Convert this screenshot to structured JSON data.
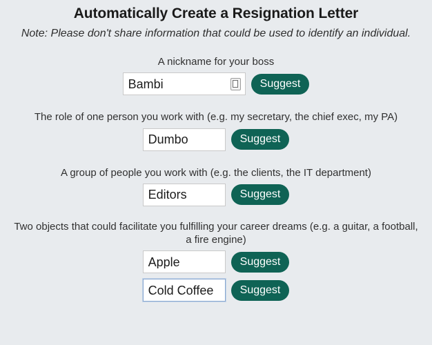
{
  "header": {
    "title": "Automatically Create a Resignation Letter",
    "note": "Note: Please don't share information that could be used to identify an individual."
  },
  "theme": {
    "background": "#e8ebee",
    "button_color": "#0f6355",
    "button_text_color": "#ffffff",
    "input_border": "#c9c9c9",
    "input_focus_border": "#8aa8d0",
    "title_color": "#1a1a1a",
    "label_color": "#303030"
  },
  "fields": [
    {
      "label": "A nickname for your boss",
      "inputs": [
        {
          "value": "Bambi",
          "placeholder": "",
          "focused": false,
          "width": "wide",
          "has_autofill_icon": true,
          "autofill_icon_name": "autofill-icon",
          "button_label": "Suggest"
        }
      ]
    },
    {
      "label": "The role of one person you work with (e.g. my secretary, the chief exec, my PA)",
      "inputs": [
        {
          "value": "Dumbo",
          "placeholder": "",
          "focused": false,
          "width": "std",
          "has_autofill_icon": false,
          "button_label": "Suggest"
        }
      ]
    },
    {
      "label": "A group of people you work with (e.g. the clients, the IT department)",
      "inputs": [
        {
          "value": "Editors",
          "placeholder": "",
          "focused": false,
          "width": "std",
          "has_autofill_icon": false,
          "button_label": "Suggest"
        }
      ]
    },
    {
      "label": "Two objects that could facilitate you fulfilling your career dreams (e.g. a guitar, a football, a fire engine)",
      "inputs": [
        {
          "value": "Apple",
          "placeholder": "",
          "focused": false,
          "width": "std",
          "has_autofill_icon": false,
          "button_label": "Suggest"
        },
        {
          "value": "Cold Coffee",
          "placeholder": "",
          "focused": true,
          "width": "std",
          "has_autofill_icon": false,
          "button_label": "Suggest"
        }
      ]
    }
  ]
}
